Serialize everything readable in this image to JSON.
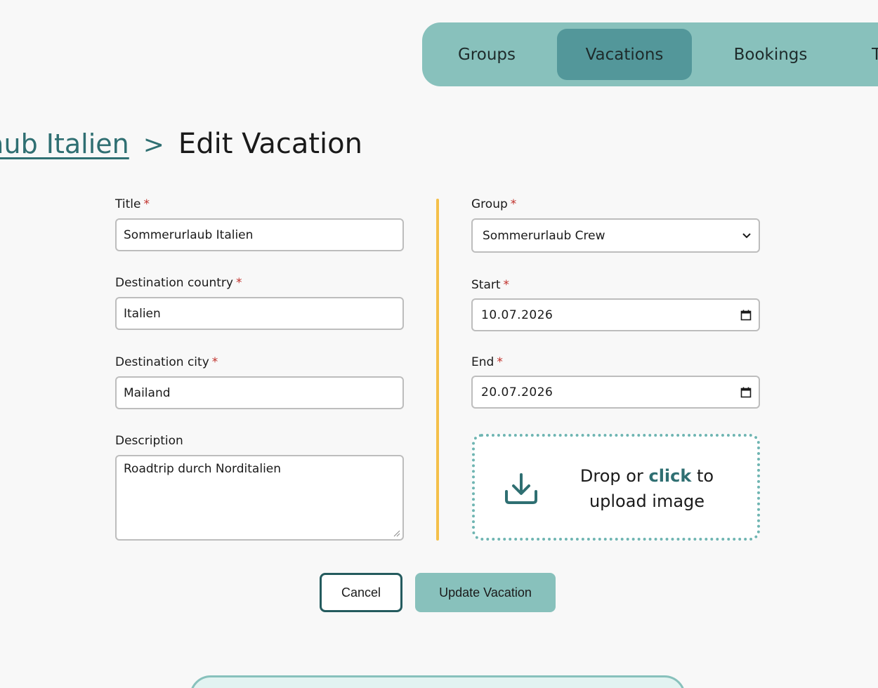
{
  "nav": {
    "items": [
      "Groups",
      "Vacations",
      "Bookings"
    ],
    "active": "Vacations",
    "more_label": "T"
  },
  "breadcrumb": {
    "parent": "Sommerurlaub Italien",
    "separator": ">",
    "current": "Edit Vacation"
  },
  "form": {
    "title": {
      "label": "Title",
      "value": "Sommerurlaub Italien"
    },
    "country": {
      "label": "Destination country",
      "value": "Italien"
    },
    "city": {
      "label": "Destination city",
      "value": "Mailand"
    },
    "description": {
      "label": "Description",
      "value": "Roadtrip durch Norditalien"
    },
    "group": {
      "label": "Group",
      "value": "Sommerurlaub Crew"
    },
    "start": {
      "label": "Start",
      "value": "10.07.2026"
    },
    "end": {
      "label": "End",
      "value": "20.07.2026"
    },
    "required_marker": "*",
    "upload": {
      "prefix": "Drop or",
      "click": "click",
      "suffix": "to",
      "line2": "upload image"
    }
  },
  "buttons": {
    "cancel": "Cancel",
    "update": "Update Vacation"
  },
  "colors": {
    "accent": "#88c1bc",
    "accent_dark": "#53979a",
    "link": "#2f6f72",
    "divider": "#f4c04a",
    "required": "#c0302a"
  },
  "icons": {
    "upload": "download-tray-icon",
    "select": "chevron-down-icon",
    "calendar": "calendar-icon"
  }
}
